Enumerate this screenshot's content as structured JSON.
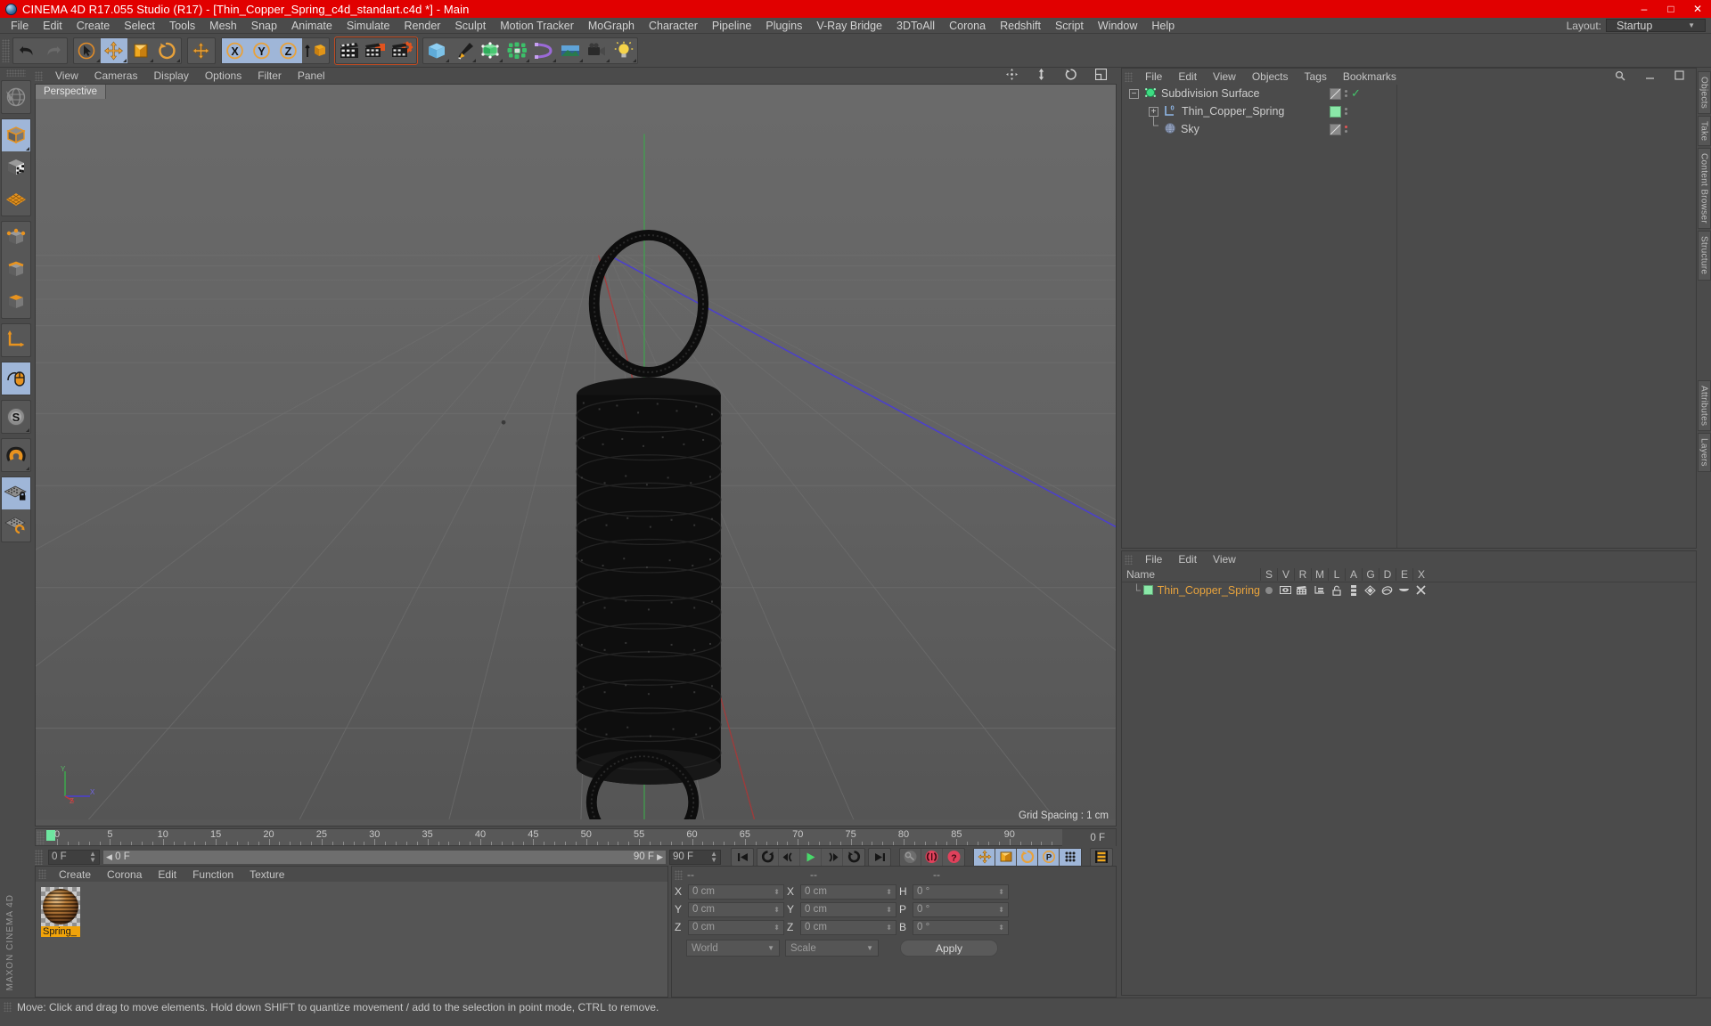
{
  "titlebar": {
    "title": "CINEMA 4D R17.055 Studio (R17) - [Thin_Copper_Spring_c4d_standart.c4d *] - Main",
    "minimize": "–",
    "maximize": "□",
    "close": "✕",
    "accent_color": "#e10000"
  },
  "menubar": {
    "items": [
      "File",
      "Edit",
      "Create",
      "Select",
      "Tools",
      "Mesh",
      "Snap",
      "Animate",
      "Simulate",
      "Render",
      "Sculpt",
      "Motion Tracker",
      "MoGraph",
      "Character",
      "Pipeline",
      "Plugins",
      "V-Ray Bridge",
      "3DToAll",
      "Corona",
      "Redshift",
      "Script",
      "Window",
      "Help"
    ],
    "layout_label": "Layout:",
    "layout_value": "Startup"
  },
  "toolbar": {
    "groups": [
      {
        "name": "undo-redo",
        "buttons": [
          {
            "name": "undo-button",
            "icon": "undo-icon",
            "selected": false
          },
          {
            "name": "redo-button",
            "icon": "redo-icon",
            "selected": false
          }
        ]
      },
      {
        "name": "transform-tools",
        "buttons": [
          {
            "name": "live-selection-button",
            "icon": "cursor-select-icon",
            "selected": false
          },
          {
            "name": "move-button",
            "icon": "move-icon",
            "selected": true
          },
          {
            "name": "scale-button",
            "icon": "scale-icon",
            "selected": false
          },
          {
            "name": "rotate-button",
            "icon": "rotate-icon",
            "selected": false
          }
        ]
      },
      {
        "name": "world-axis",
        "buttons": [
          {
            "name": "world-coordinate-button",
            "icon": "move-icon",
            "selected": false
          }
        ]
      },
      {
        "name": "axis-locks",
        "buttons": [
          {
            "name": "x-axis-button",
            "icon": "x-axis-icon",
            "selected": true
          },
          {
            "name": "y-axis-button",
            "icon": "y-axis-icon",
            "selected": true
          },
          {
            "name": "z-axis-button",
            "icon": "z-axis-icon",
            "selected": true
          },
          {
            "name": "object-world-button",
            "icon": "object-axis-icon",
            "selected": false
          }
        ]
      },
      {
        "name": "render-tools",
        "buttons": [
          {
            "name": "render-view-button",
            "icon": "clapperboard-icon",
            "selected": false
          },
          {
            "name": "render-to-picture-viewer-button",
            "icon": "clapperboard-picture-icon",
            "selected": false
          },
          {
            "name": "render-settings-button",
            "icon": "clapperboard-gear-icon",
            "selected": false
          }
        ]
      },
      {
        "name": "creation-tools",
        "buttons": [
          {
            "name": "add-cube-button",
            "icon": "cube-icon",
            "selected": false
          },
          {
            "name": "add-spline-button",
            "icon": "pen-icon",
            "selected": false
          },
          {
            "name": "add-nurbs-button",
            "icon": "nurbs-icon",
            "selected": false
          },
          {
            "name": "add-array-button",
            "icon": "array-icon",
            "selected": false
          },
          {
            "name": "add-deformer-button",
            "icon": "deformer-icon",
            "selected": false
          },
          {
            "name": "add-environment-button",
            "icon": "environment-icon",
            "selected": false
          },
          {
            "name": "add-camera-button",
            "icon": "camera-icon",
            "selected": false
          },
          {
            "name": "add-light-button",
            "icon": "light-bulb-icon",
            "selected": false
          }
        ]
      }
    ]
  },
  "leftbar": {
    "buttons": [
      {
        "name": "undo-view-button",
        "icon": "globe-icon",
        "selected": false
      },
      {
        "name": "model-mode-button",
        "icon": "model-cube-icon",
        "selected": true
      },
      {
        "name": "texture-mode-button",
        "icon": "texture-cube-icon",
        "selected": false
      },
      {
        "name": "workplane-mode-button",
        "icon": "workplane-grid-icon",
        "selected": false
      },
      {
        "name": "points-mode-button",
        "icon": "points-cube-icon",
        "selected": false
      },
      {
        "name": "edges-mode-button",
        "icon": "edges-cube-icon",
        "selected": false
      },
      {
        "name": "polygons-mode-button",
        "icon": "polygons-cube-icon",
        "selected": false
      },
      {
        "name": "axis-modification-button",
        "icon": "axis-arrows-icon",
        "selected": false
      },
      {
        "name": "enable-tweak-button",
        "icon": "mouse-icon",
        "selected": true
      },
      {
        "name": "soft-selection-button",
        "icon": "soft-selection-s-icon",
        "selected": false
      },
      {
        "name": "snap-magnet-button",
        "icon": "magnet-icon",
        "selected": false
      },
      {
        "name": "lock-workplane-button",
        "icon": "workplane-lock-icon",
        "selected": true
      },
      {
        "name": "workplane-rotate-button",
        "icon": "workplane-rotate-icon",
        "selected": false
      }
    ],
    "branding_line1": "MAXON",
    "branding_line2": "CINEMA 4D"
  },
  "viewport": {
    "menu": [
      "View",
      "Cameras",
      "Display",
      "Options",
      "Filter",
      "Panel"
    ],
    "tab_label": "Perspective",
    "grid_spacing": "Grid Spacing : 1 cm",
    "axis_labels": {
      "y": "Y",
      "x": "X",
      "z": "Z"
    },
    "object_description": "Thin copper spring coil — black dense-mesh helical spring with top and bottom loops"
  },
  "timeline": {
    "ticks": [
      {
        "label": "0",
        "pos": 0
      },
      {
        "label": "5",
        "pos": 5
      },
      {
        "label": "10",
        "pos": 10
      },
      {
        "label": "15",
        "pos": 15
      },
      {
        "label": "20",
        "pos": 20
      },
      {
        "label": "25",
        "pos": 25
      },
      {
        "label": "30",
        "pos": 30
      },
      {
        "label": "35",
        "pos": 35
      },
      {
        "label": "40",
        "pos": 40
      },
      {
        "label": "45",
        "pos": 45
      },
      {
        "label": "50",
        "pos": 50
      },
      {
        "label": "55",
        "pos": 55
      },
      {
        "label": "60",
        "pos": 60
      },
      {
        "label": "65",
        "pos": 65
      },
      {
        "label": "70",
        "pos": 70
      },
      {
        "label": "75",
        "pos": 75
      },
      {
        "label": "80",
        "pos": 80
      },
      {
        "label": "85",
        "pos": 85
      },
      {
        "label": "90",
        "pos": 90
      }
    ],
    "current_frame_right": "0 F",
    "current_frame": "0 F",
    "range_start": "0 F",
    "range_end": "90 F",
    "max_frame": "90 F",
    "playback_buttons": [
      {
        "name": "go-to-start-button",
        "icon": "skip-start-icon",
        "selected": false
      },
      {
        "name": "play-reverse-button",
        "icon": "rewind-loop-icon",
        "selected": false
      },
      {
        "name": "previous-key-button",
        "icon": "prev-key-icon",
        "selected": false
      },
      {
        "name": "play-button",
        "icon": "play-icon",
        "selected": false
      },
      {
        "name": "next-key-button",
        "icon": "next-key-icon",
        "selected": false
      },
      {
        "name": "play-forward-loop-button",
        "icon": "forward-loop-icon",
        "selected": false
      },
      {
        "name": "go-to-end-button",
        "icon": "skip-end-icon",
        "selected": false
      },
      {
        "name": "record-active-objects-button",
        "icon": "key-icon",
        "selected": false
      },
      {
        "name": "autokeying-button",
        "icon": "record-circle-icon",
        "selected": false
      },
      {
        "name": "keyframe-selection-button",
        "icon": "question-circle-icon",
        "selected": false
      },
      {
        "name": "record-position-button",
        "icon": "move-icon",
        "selected": true
      },
      {
        "name": "record-scale-button",
        "icon": "scale-icon",
        "selected": true
      },
      {
        "name": "record-rotation-button",
        "icon": "rotate-icon",
        "selected": true
      },
      {
        "name": "record-parameter-button",
        "icon": "parameter-p-icon",
        "selected": true
      },
      {
        "name": "record-pla-button",
        "icon": "point-level-animation-icon",
        "selected": true
      },
      {
        "name": "timeline-button",
        "icon": "film-strip-icon",
        "selected": false
      }
    ]
  },
  "material_manager": {
    "menu": [
      "Create",
      "Corona",
      "Edit",
      "Function",
      "Texture"
    ],
    "materials": [
      {
        "name": "Spring_",
        "label": "Spring_",
        "selected": true
      }
    ]
  },
  "coordinates": {
    "headers": [
      "--",
      "--",
      "--"
    ],
    "rows": [
      {
        "label1": "X",
        "value1": "0 cm",
        "label2": "X",
        "value2": "0 cm",
        "label3": "H",
        "value3": "0 °"
      },
      {
        "label1": "Y",
        "value1": "0 cm",
        "label2": "Y",
        "value2": "0 cm",
        "label3": "P",
        "value3": "0 °"
      },
      {
        "label1": "Z",
        "value1": "0 cm",
        "label2": "Z",
        "value2": "0 cm",
        "label3": "B",
        "value3": "0 °"
      }
    ],
    "coordinate_system": "World",
    "mode": "Scale",
    "apply_label": "Apply"
  },
  "object_manager": {
    "menu": [
      "File",
      "Edit",
      "View",
      "Objects",
      "Tags",
      "Bookmarks"
    ],
    "objects": [
      {
        "name": "Subdivision Surface",
        "depth": 0,
        "expander": "−",
        "icon": "subdivision-surface-icon",
        "highlight": false,
        "tag1": "diag",
        "check": true,
        "dot": false
      },
      {
        "name": "Thin_Copper_Spring",
        "depth": 1,
        "expander": "+",
        "icon": "null-object-icon",
        "highlight": false,
        "tag1": "green",
        "check": false,
        "dot": false
      },
      {
        "name": "Sky",
        "depth": 1,
        "expander": "",
        "icon": "sky-icon",
        "highlight": false,
        "tag1": "diag",
        "check": false,
        "dot": true
      }
    ]
  },
  "layer_manager": {
    "menu": [
      "File",
      "Edit",
      "View"
    ],
    "columns": [
      "Name",
      "S",
      "V",
      "R",
      "M",
      "L",
      "A",
      "G",
      "D",
      "E",
      "X"
    ],
    "rows": [
      {
        "name": "Thin_Copper_Spring",
        "color": "#8ae8a8"
      }
    ]
  },
  "right_tabs": [
    "Objects",
    "Take",
    "Content Browser",
    "Structure"
  ],
  "far_right_tabs": [
    "Attributes",
    "Layers"
  ],
  "statusbar": {
    "message": "Move: Click and drag to move elements. Hold down SHIFT to quantize movement / add to the selection in point mode, CTRL to remove."
  }
}
